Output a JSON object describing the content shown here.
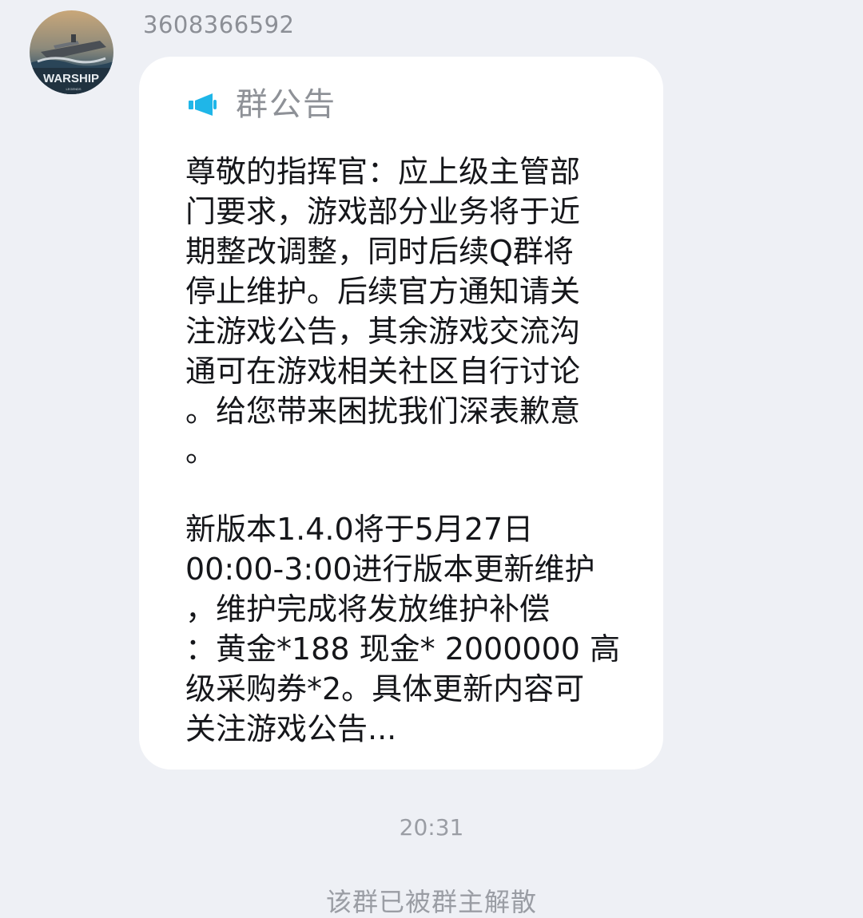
{
  "message": {
    "avatar": {
      "icon": "warship-game-logo-icon",
      "logo_text": "WARSHIP",
      "logo_subtext": "LEGENDS"
    },
    "sender_name": "3608366592",
    "notice": {
      "icon": "megaphone-icon",
      "icon_color": "#1fb6e8",
      "title": "群公告",
      "paragraph_1_lines": [
        "尊敬的指挥官：应上级主管部",
        "门要求，游戏部分业务将于近",
        "期整改调整，同时后续Q群将",
        "停止维护。后续官方通知请关",
        "注游戏公告，其余游戏交流沟",
        "通可在游戏相关社区自行讨论",
        "。给您带来困扰我们深表歉意",
        "。"
      ],
      "paragraph_2_lines": [
        "新版本1.4.0将于5月27日",
        "00:00-3:00进行版本更新维护",
        "，维护完成将发放维护补偿",
        "：黄金*188 现金* 2000000 高",
        "级采购券*2。具体更新内容可",
        "关注游戏公告..."
      ]
    }
  },
  "timestamp": "20:31",
  "system_message": "该群已被群主解散",
  "colors": {
    "background": "#eef0f5",
    "bubble": "#ffffff",
    "accent": "#1fb6e8",
    "muted_text": "#9a9da4",
    "body_text": "#15161a"
  }
}
